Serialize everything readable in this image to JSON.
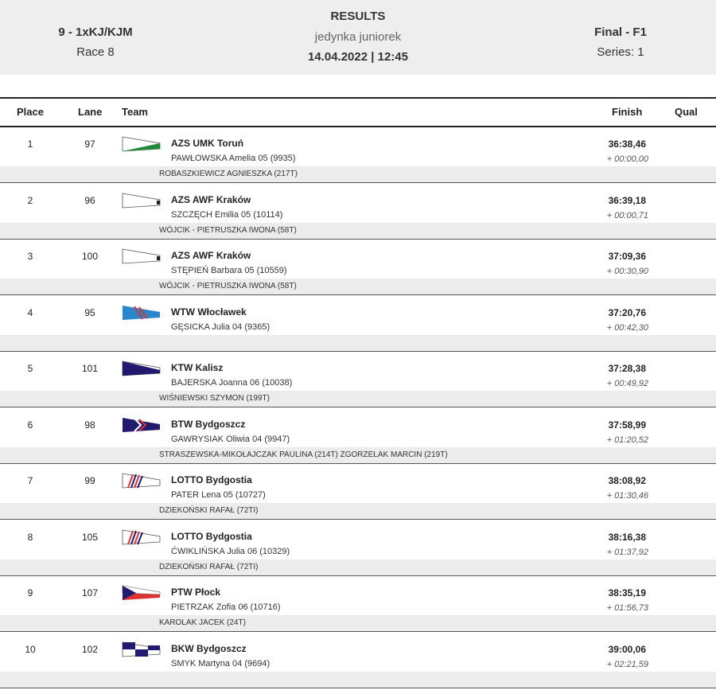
{
  "header": {
    "event": "9 - 1xKJ/KJM",
    "race": "Race 8",
    "title": "RESULTS",
    "subtitle": "jedynka juniorek",
    "datetime": "14.04.2022 | 12:45",
    "final": "Final - F1",
    "series": "Series: 1"
  },
  "columns": {
    "place": "Place",
    "lane": "Lane",
    "team": "Team",
    "finish": "Finish",
    "qual": "Qual"
  },
  "rows": [
    {
      "place": "1",
      "lane": "97",
      "team": "AZS UMK Toruń",
      "athlete": "PAWŁOWSKA  Amelia 05 (9935)",
      "finish": "36:38,46",
      "delta": "+ 00:00,00",
      "coach": "ROBASZKIEWICZ AGNIESZKA (217T)",
      "flag": "green"
    },
    {
      "place": "2",
      "lane": "96",
      "team": "AZS AWF Kraków",
      "athlete": "SZCZĘCH  Emilia 05 (10114)",
      "finish": "36:39,18",
      "delta": "+ 00:00,71",
      "coach": "WÓJCIK - PIETRUSZKA IWONA (58T)",
      "flag": "white"
    },
    {
      "place": "3",
      "lane": "100",
      "team": "AZS AWF Kraków",
      "athlete": "STĘPIEŃ  Barbara 05 (10559)",
      "finish": "37:09,36",
      "delta": "+ 00:30,90",
      "coach": "WÓJCIK - PIETRUSZKA IWONA (58T)",
      "flag": "white"
    },
    {
      "place": "4",
      "lane": "95",
      "team": "WTW Włocławek",
      "athlete": "GĘSICKA  Julia 04 (9365)",
      "finish": "37:20,76",
      "delta": "+ 00:42,30",
      "coach": "",
      "flag": "blue-red"
    },
    {
      "place": "5",
      "lane": "101",
      "team": "KTW Kalisz",
      "athlete": "BAJERSKA  Joanna 06 (10038)",
      "finish": "37:28,38",
      "delta": "+ 00:49,92",
      "coach": "WIŚNIEWSKI SZYMON (199T)",
      "flag": "navy-white"
    },
    {
      "place": "6",
      "lane": "98",
      "team": "BTW Bydgoszcz",
      "athlete": "GAWRYSIAK  Oliwia 04 (9947)",
      "finish": "37:58,99",
      "delta": "+ 01:20,52",
      "coach": "STRASZEWSKA-MIKOŁAJCZAK PAULINA (214T) ZGORZELAK MARCIN (219T)",
      "flag": "navy-red"
    },
    {
      "place": "7",
      "lane": "99",
      "team": "LOTTO Bydgostia",
      "athlete": "PATER  Lena 05 (10727)",
      "finish": "38:08,92",
      "delta": "+ 01:30,46",
      "coach": "DZIEKOŃSKI RAFAŁ (72TI)",
      "flag": "stripes"
    },
    {
      "place": "8",
      "lane": "105",
      "team": "LOTTO Bydgostia",
      "athlete": "ĆWIKLIŃSKA  Julia 06 (10329)",
      "finish": "38:16,38",
      "delta": "+ 01:37,92",
      "coach": "DZIEKOŃSKI RAFAŁ (72TI)",
      "flag": "stripes"
    },
    {
      "place": "9",
      "lane": "107",
      "team": "PTW Płock",
      "athlete": "PIETRZAK  Zofia 06 (10716)",
      "finish": "38:35,19",
      "delta": "+ 01:56,73",
      "coach": "KAROLAK JACEK (24T)",
      "flag": "czech"
    },
    {
      "place": "10",
      "lane": "102",
      "team": "BKW Bydgoszcz",
      "athlete": "SMYK  Martyna 04 (9694)",
      "finish": "39:00,06",
      "delta": "+ 02:21,59",
      "coach": "",
      "flag": "checker"
    }
  ]
}
